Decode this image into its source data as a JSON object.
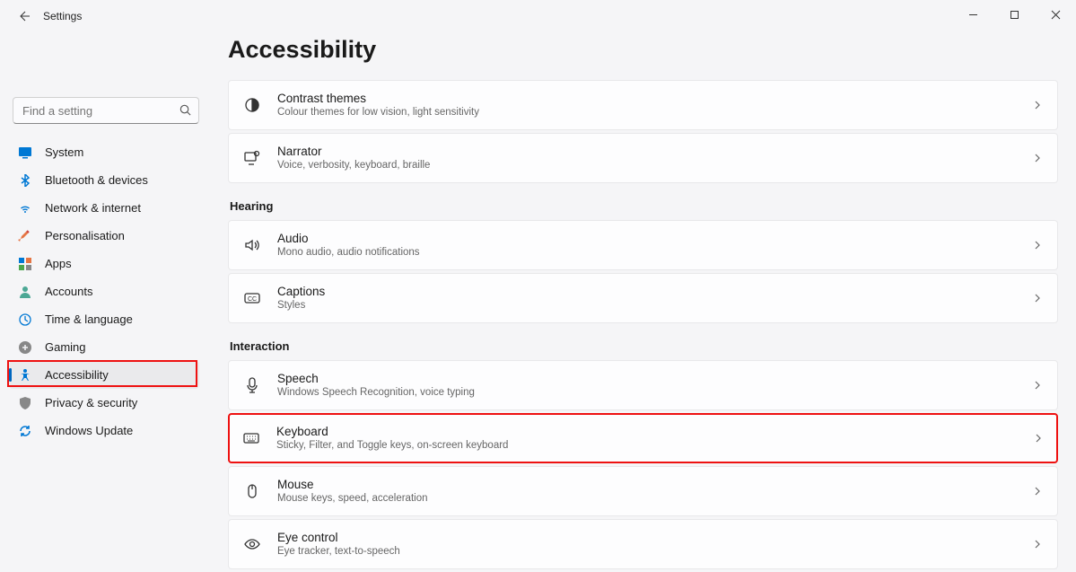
{
  "app_title": "Settings",
  "search": {
    "placeholder": "Find a setting"
  },
  "nav": [
    {
      "key": "system",
      "label": "System"
    },
    {
      "key": "bluetooth",
      "label": "Bluetooth & devices"
    },
    {
      "key": "network",
      "label": "Network & internet"
    },
    {
      "key": "personalisation",
      "label": "Personalisation"
    },
    {
      "key": "apps",
      "label": "Apps"
    },
    {
      "key": "accounts",
      "label": "Accounts"
    },
    {
      "key": "time",
      "label": "Time & language"
    },
    {
      "key": "gaming",
      "label": "Gaming"
    },
    {
      "key": "accessibility",
      "label": "Accessibility"
    },
    {
      "key": "privacy",
      "label": "Privacy & security"
    },
    {
      "key": "update",
      "label": "Windows Update"
    }
  ],
  "page": {
    "title": "Accessibility"
  },
  "sections": {
    "vision_tail": [
      {
        "key": "contrast",
        "title": "Contrast themes",
        "sub": "Colour themes for low vision, light sensitivity"
      },
      {
        "key": "narrator",
        "title": "Narrator",
        "sub": "Voice, verbosity, keyboard, braille"
      }
    ],
    "hearing_label": "Hearing",
    "hearing": [
      {
        "key": "audio",
        "title": "Audio",
        "sub": "Mono audio, audio notifications"
      },
      {
        "key": "captions",
        "title": "Captions",
        "sub": "Styles"
      }
    ],
    "interaction_label": "Interaction",
    "interaction": [
      {
        "key": "speech",
        "title": "Speech",
        "sub": "Windows Speech Recognition, voice typing"
      },
      {
        "key": "keyboard",
        "title": "Keyboard",
        "sub": "Sticky, Filter, and Toggle keys, on-screen keyboard"
      },
      {
        "key": "mouse",
        "title": "Mouse",
        "sub": "Mouse keys, speed, acceleration"
      },
      {
        "key": "eyecontrol",
        "title": "Eye control",
        "sub": "Eye tracker, text-to-speech"
      }
    ]
  }
}
